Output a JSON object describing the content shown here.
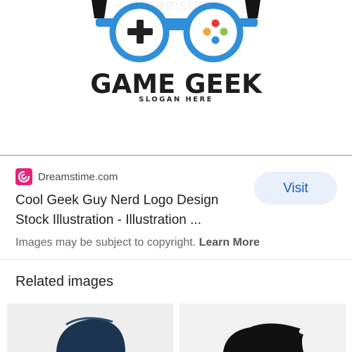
{
  "logo": {
    "title": "GAME GEEK",
    "slogan": "SLOGAN HERE",
    "watermark": "dreamstime",
    "frame_color": "#2f8fd9",
    "button_colors": {
      "left": "#f5a23a",
      "top": "#e53935",
      "right": "#8bc34a",
      "bottom": "#2f8fd9"
    }
  },
  "result": {
    "source_icon": "dreamstime-logo-icon",
    "source_name": "Dreamstime.com",
    "title": "Cool Geek Guy Nerd Logo Design Stock Illustration - Illustration ...",
    "visit_label": "Visit",
    "copyright_text": "Images may be subject to copyright.",
    "learn_more_label": "Learn More"
  },
  "related": {
    "heading": "Related images",
    "thumbnails": [
      {
        "name": "geek-hair-logo-thumbnail-1",
        "hair_color": "#1b3550"
      },
      {
        "name": "geek-hair-logo-thumbnail-2",
        "hair_color": "#111111"
      }
    ]
  },
  "colors": {
    "accent": "#1a57c4",
    "visit_button_bg": "#e8f0fb",
    "source_icon_bg": "#e6227a"
  }
}
